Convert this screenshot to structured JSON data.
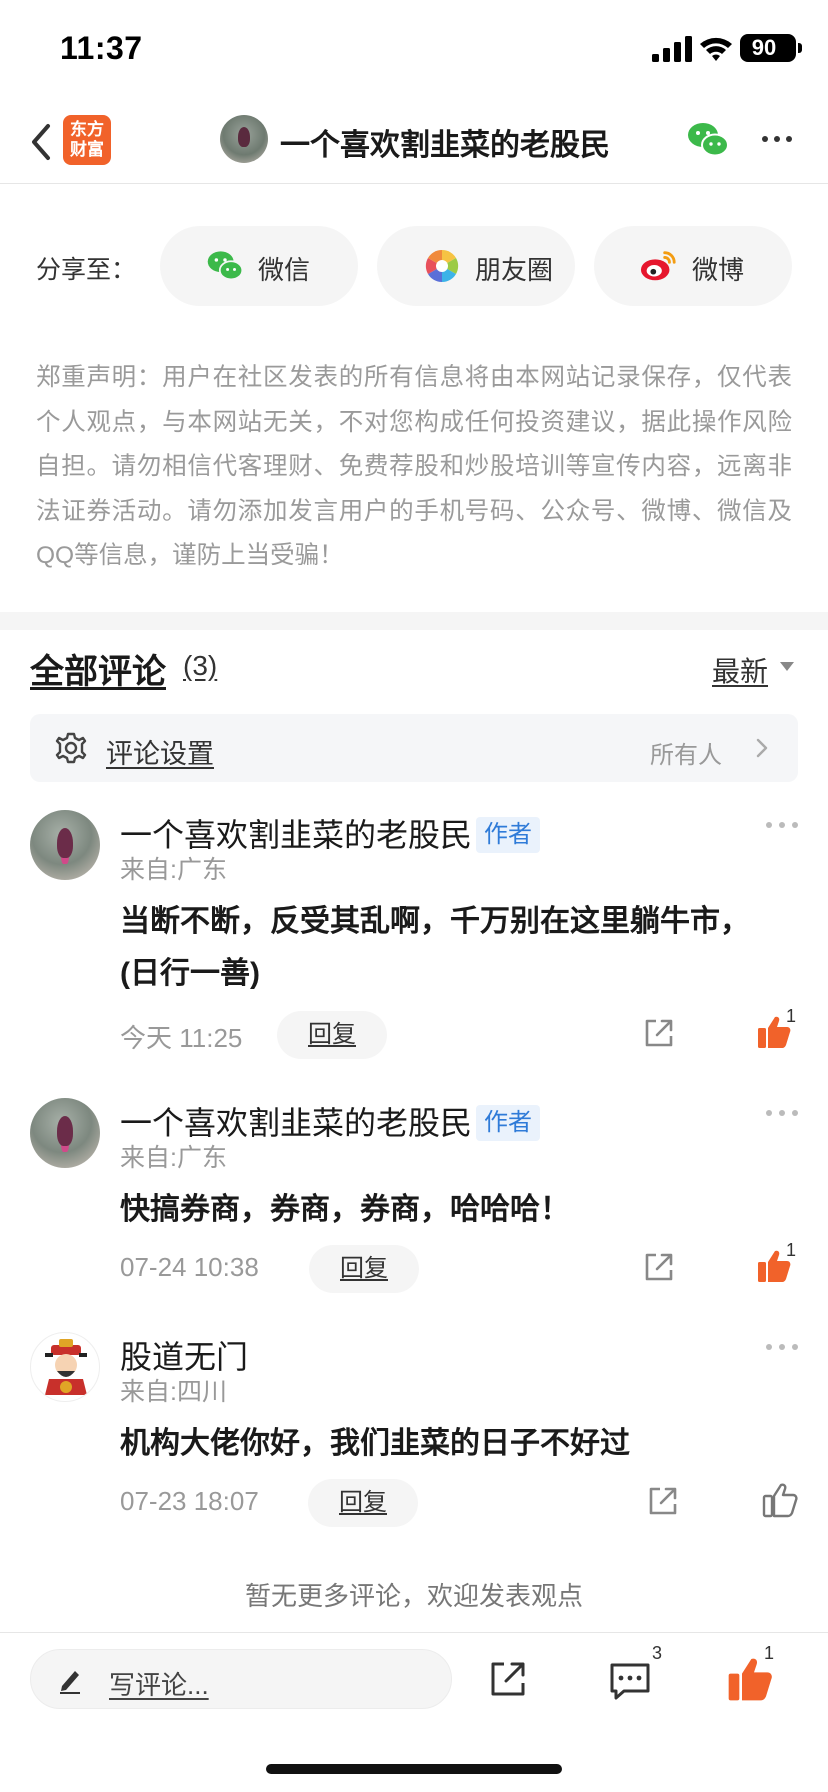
{
  "status_bar": {
    "time": "11:37",
    "battery": "90"
  },
  "nav": {
    "logo": "东方\n财富",
    "title": "一个喜欢割韭菜的老股民"
  },
  "share": {
    "label": "分享至：",
    "buttons": [
      {
        "label": "微信",
        "icon": "wechat-icon"
      },
      {
        "label": "朋友圈",
        "icon": "moments-icon"
      },
      {
        "label": "微博",
        "icon": "weibo-icon"
      }
    ]
  },
  "disclaimer": "郑重声明：用户在社区发表的所有信息将由本网站记录保存，仅代表个人观点，与本网站无关，不对您构成任何投资建议，据此操作风险自担。请勿相信代客理财、免费荐股和炒股培训等宣传内容，远离非法证券活动。请勿添加发言用户的手机号码、公众号、微博、微信及QQ等信息，谨防上当受骗！",
  "comments_header": {
    "title": "全部评论",
    "count": "(3)",
    "sort": "最新"
  },
  "settings": {
    "label": "评论设置",
    "value": "所有人"
  },
  "comments": [
    {
      "name": "一个喜欢割韭菜的老股民",
      "tag": "作者",
      "location": "来自:广东",
      "text": "当断不断，反受其乱啊，千万别在这里躺牛市，(日行一善)",
      "time": "今天 11:25",
      "reply": "回复",
      "likes": "1"
    },
    {
      "name": "一个喜欢割韭菜的老股民",
      "tag": "作者",
      "location": "来自:广东",
      "text": "快搞券商，券商，券商，哈哈哈！",
      "time": "07-24 10:38",
      "reply": "回复",
      "likes": "1"
    },
    {
      "name": "股道无门",
      "tag": "",
      "location": "来自:四川",
      "text": "机构大佬你好，我们韭菜的日子不好过",
      "time": "07-23 18:07",
      "reply": "回复",
      "likes": ""
    }
  ],
  "no_more": "暂无更多评论，欢迎发表观点",
  "bottom_bar": {
    "placeholder": "写评论...",
    "comment_count": "3",
    "like_count": "1"
  },
  "colors": {
    "accent": "#f1622a",
    "like": "#f1622a",
    "tag": "#2f7bd8",
    "wechat": "#3cb94a",
    "weibo": "#e6162d"
  }
}
